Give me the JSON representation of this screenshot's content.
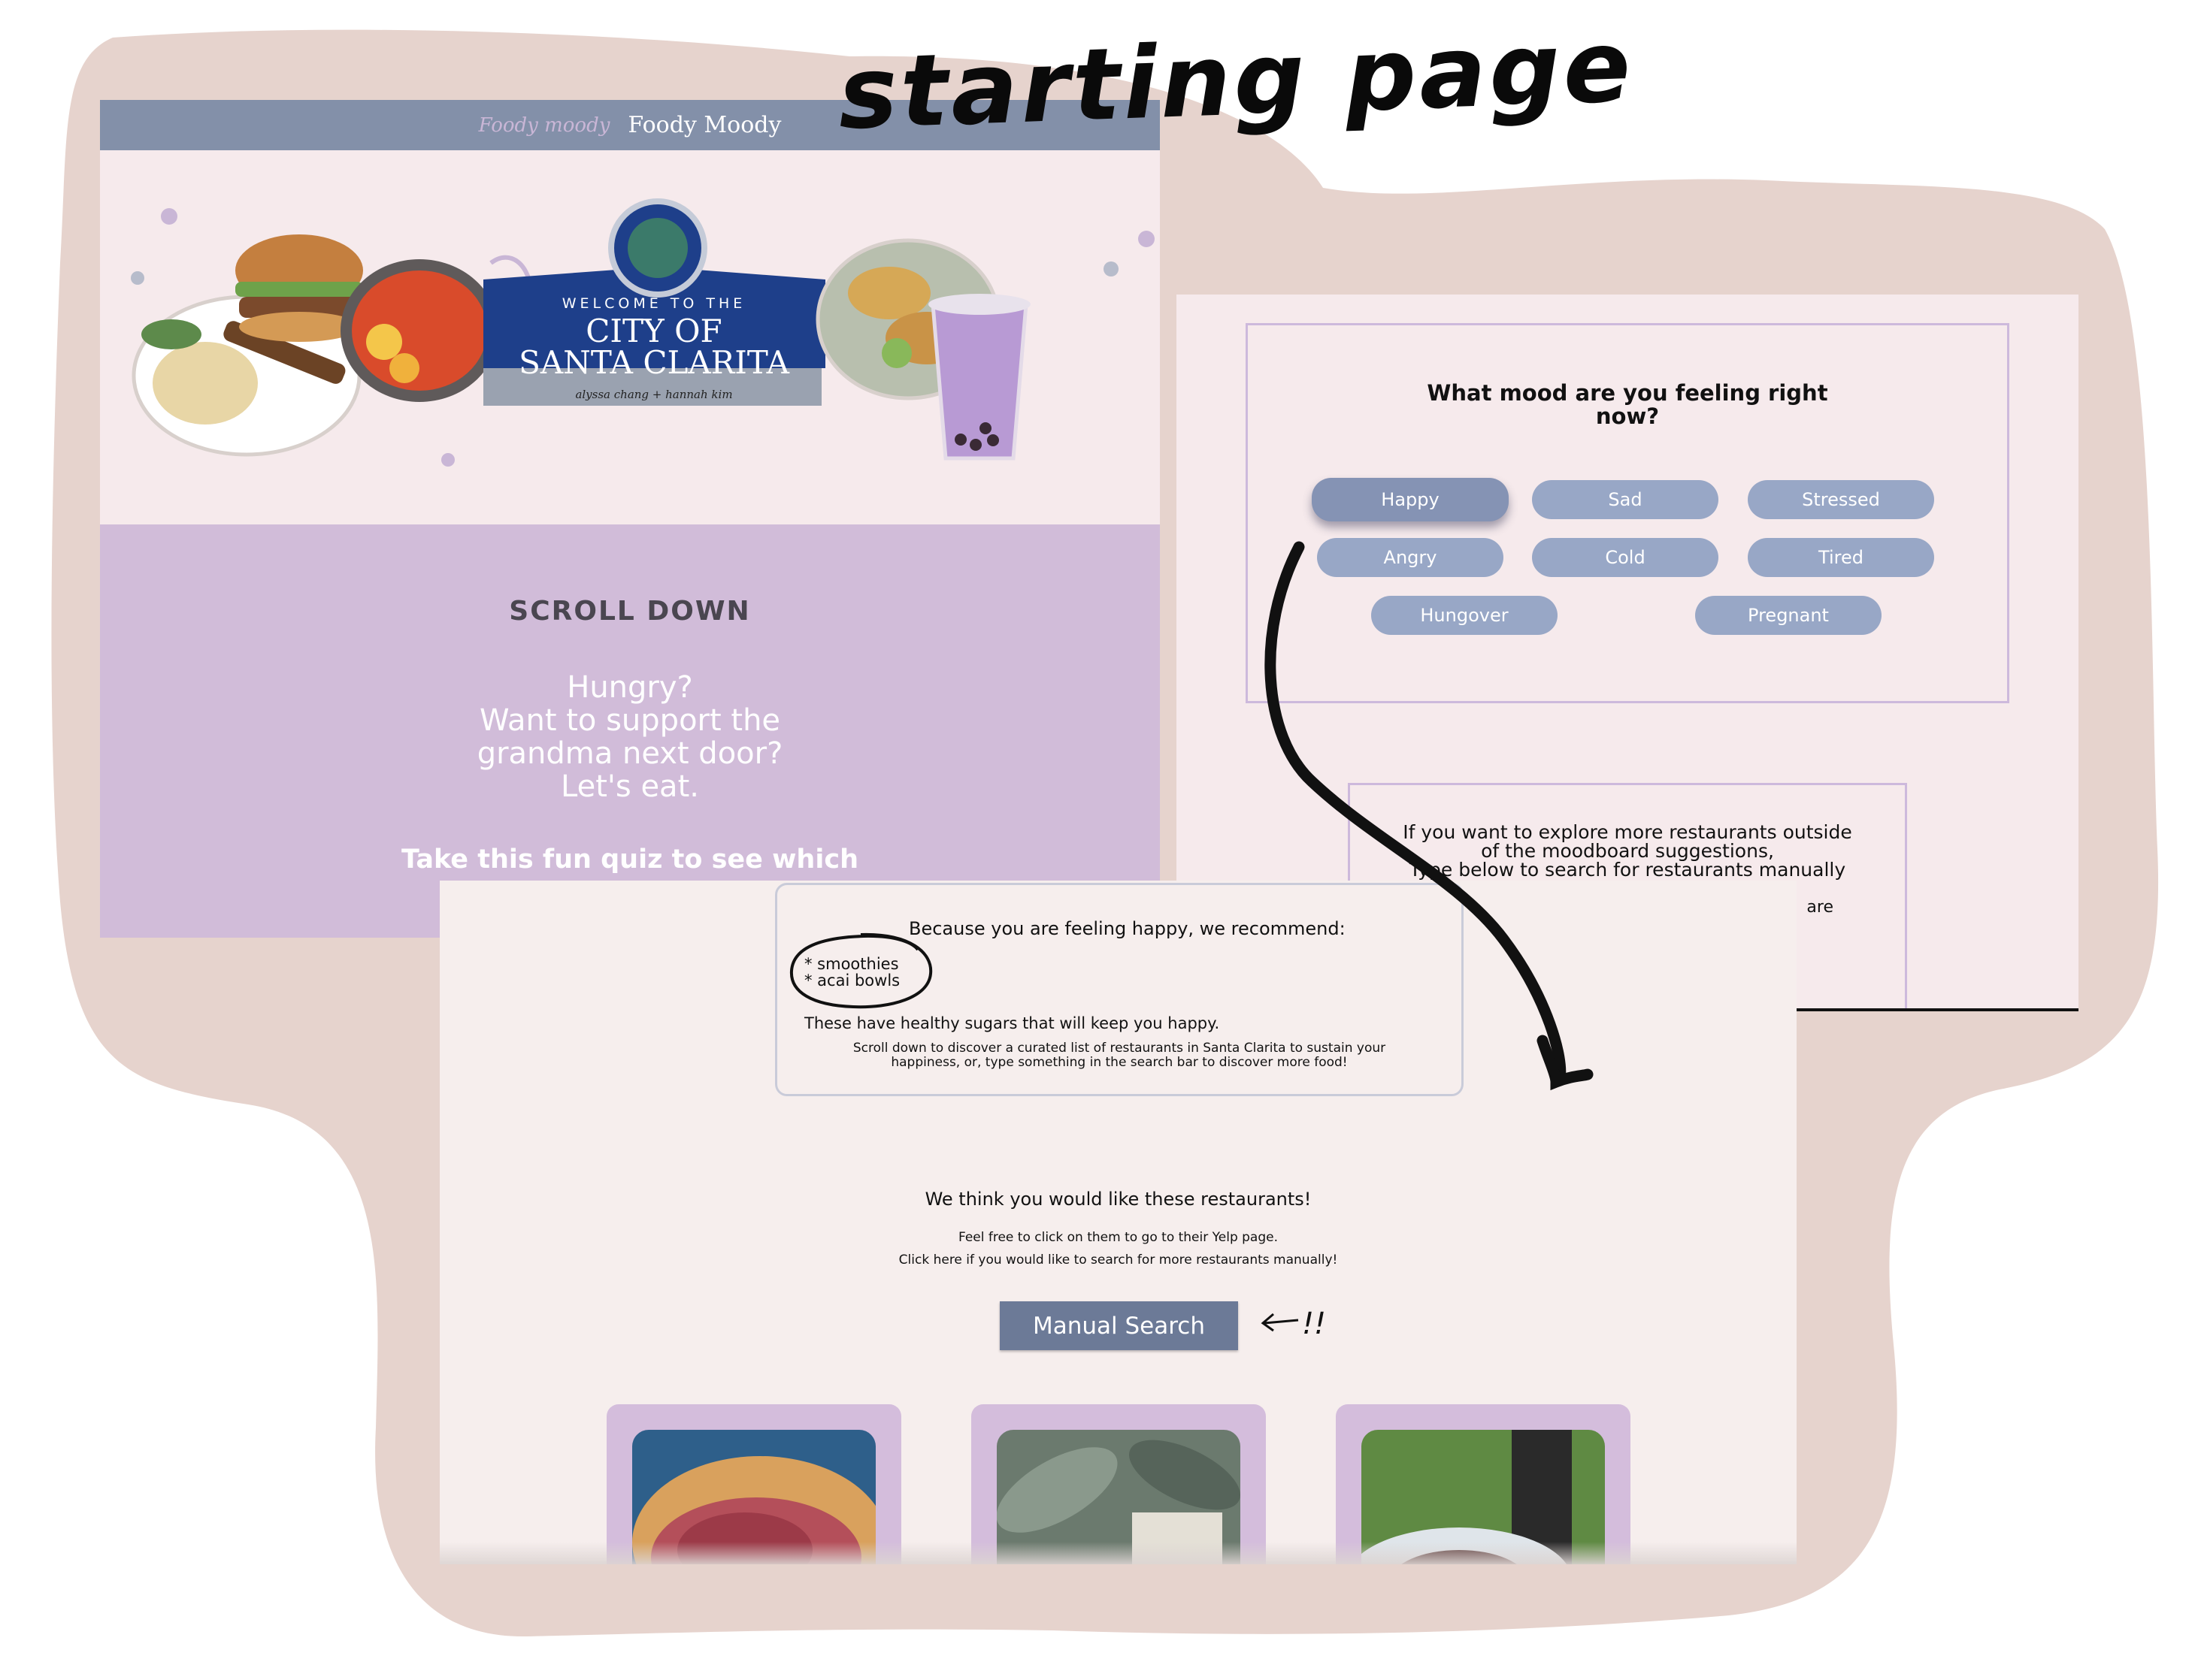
{
  "annotation": {
    "title": "starting page",
    "button_note": "!!"
  },
  "start_page": {
    "logo_text": "Foody moody",
    "site_title": "Foody Moody",
    "hero_sign": {
      "welcome": "WELCOME TO THE",
      "city_line1": "CITY OF",
      "city_line2": "SANTA CLARITA",
      "credit": "alyssa chang + hannah kim"
    },
    "scroll_down": "SCROLL DOWN",
    "hungry_lines": [
      "Hungry?",
      "Want to support the",
      "grandma next door?",
      "Let's eat."
    ],
    "quiz_cta": "Take this fun quiz to see which"
  },
  "quiz": {
    "question_line1": "What mood are you feeling right",
    "question_line2": "now?",
    "moods": [
      "Happy",
      "Sad",
      "Stressed",
      "Angry",
      "Cold",
      "Tired",
      "Hungover",
      "Pregnant"
    ],
    "selected": "Happy",
    "manual_lines": [
      "If you want to explore more restaurants outside",
      "of the moodboard suggestions,",
      "Type below to search for restaurants manually"
    ],
    "manual_fade_word": "are"
  },
  "results": {
    "heading": "Because you are feeling happy, we recommend:",
    "items": [
      "* smoothies",
      "* acai bowls"
    ],
    "reason": "These have healthy sugars that will keep you happy.",
    "scroll_line1": "Scroll down to discover a curated list of restaurants in Santa Clarita to sustain your",
    "scroll_line2": "happiness, or, type something in the search bar to discover more food!",
    "suggest_title": "We think you would like these restaurants!",
    "suggest_sub1": "Feel free to click on them to go to their Yelp page.",
    "suggest_sub2": "Click here if you would like to search for more restaurants manually!",
    "manual_search_label": "Manual Search"
  },
  "colors": {
    "background_blob": "#e6d3cd",
    "header": "#8390a9",
    "lavender": "#d1bcd9",
    "mood_button": "#98a7c6",
    "manual_search_button": "#6c7a97"
  }
}
